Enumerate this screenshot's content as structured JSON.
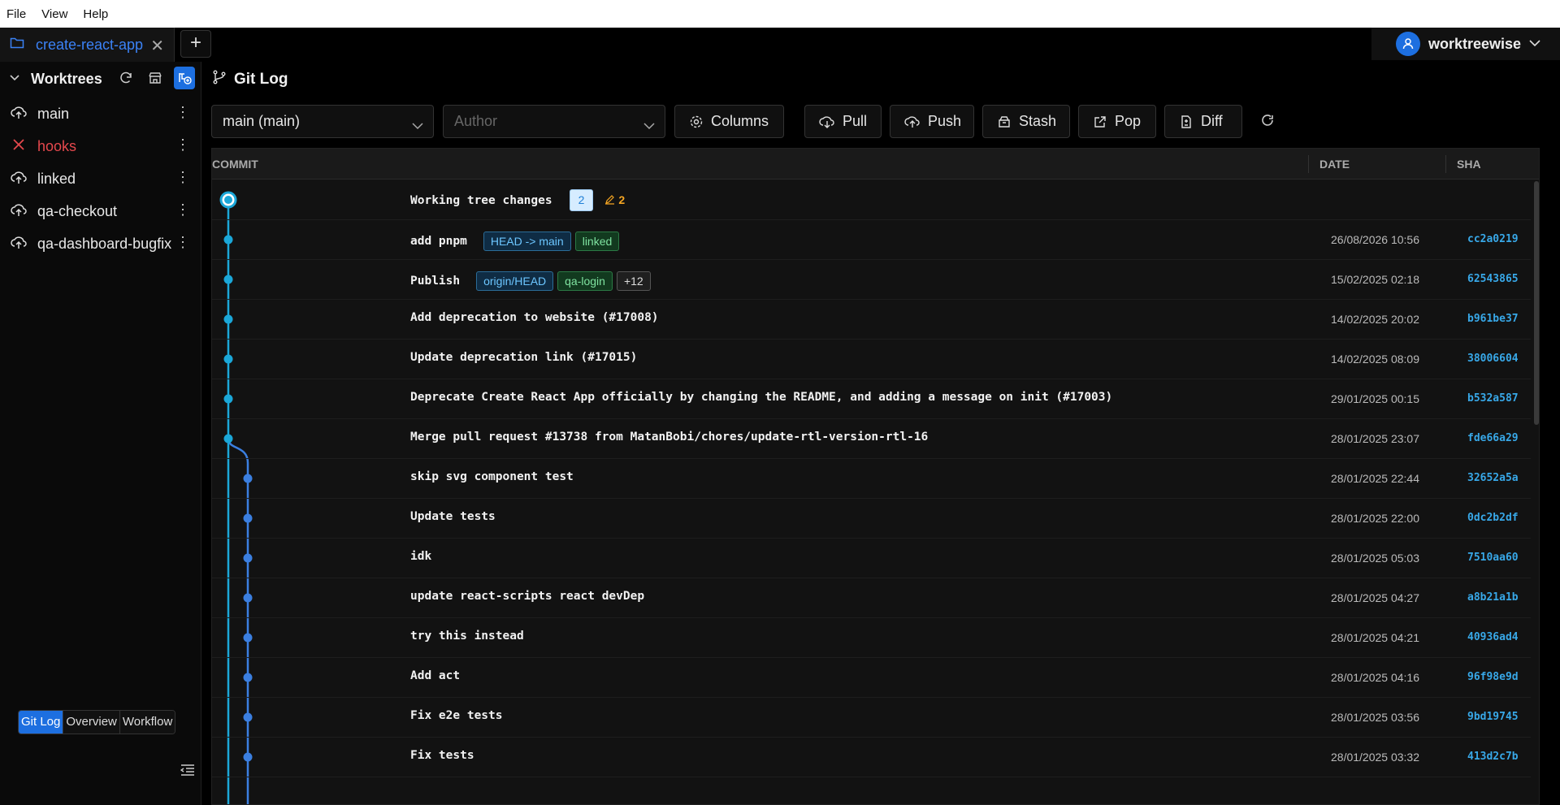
{
  "menu": [
    "File",
    "View",
    "Help"
  ],
  "tab": {
    "label": "create-react-app"
  },
  "user": {
    "name": "worktreewise"
  },
  "sidebar": {
    "title": "Worktrees",
    "items": [
      {
        "label": "main",
        "status": "cloud"
      },
      {
        "label": "hooks",
        "status": "error"
      },
      {
        "label": "linked",
        "status": "cloud"
      },
      {
        "label": "qa-checkout",
        "status": "cloud"
      },
      {
        "label": "qa-dashboard-bugfix",
        "status": "cloud"
      }
    ],
    "view_tabs": [
      "Git Log",
      "Overview",
      "Workflow"
    ]
  },
  "gitlog": {
    "title": "Git Log",
    "branch_select": "main (main)",
    "author_placeholder": "Author",
    "buttons": {
      "columns": "Columns",
      "pull": "Pull",
      "push": "Push",
      "stash": "Stash",
      "pop": "Pop",
      "diff": "Diff"
    },
    "columns": {
      "commit": "COMMIT",
      "date": "DATE",
      "sha": "SHA"
    },
    "working": {
      "label": "Working tree changes",
      "count": "2",
      "changes": "2"
    },
    "rows": [
      {
        "message": "add pnpm",
        "tags": [
          {
            "text": "HEAD -> main",
            "kind": "head"
          },
          {
            "text": "linked",
            "kind": "branch"
          }
        ],
        "date": "26/08/2026 10:56",
        "sha": "cc2a0219"
      },
      {
        "message": "Publish",
        "tags": [
          {
            "text": "origin/HEAD",
            "kind": "head"
          },
          {
            "text": "qa-login",
            "kind": "branch"
          },
          {
            "text": "+12",
            "kind": "more"
          }
        ],
        "date": "15/02/2025 02:18",
        "sha": "62543865"
      },
      {
        "message": "Add deprecation to website (#17008)",
        "tags": [],
        "date": "14/02/2025 20:02",
        "sha": "b961be37"
      },
      {
        "message": "Update deprecation link (#17015)",
        "tags": [],
        "date": "14/02/2025 08:09",
        "sha": "38006604"
      },
      {
        "message": "Deprecate Create React App officially by changing the README, and adding a message on init (#17003)",
        "tags": [],
        "date": "29/01/2025 00:15",
        "sha": "b532a587"
      },
      {
        "message": "Merge pull request #13738 from MatanBobi/chores/update-rtl-version-rtl-16",
        "tags": [],
        "date": "28/01/2025 23:07",
        "sha": "fde66a29"
      },
      {
        "message": "skip svg component test",
        "tags": [],
        "date": "28/01/2025 22:44",
        "sha": "32652a5a"
      },
      {
        "message": "Update tests",
        "tags": [],
        "date": "28/01/2025 22:00",
        "sha": "0dc2b2df"
      },
      {
        "message": "idk",
        "tags": [],
        "date": "28/01/2025 05:03",
        "sha": "7510aa60"
      },
      {
        "message": "update react-scripts react devDep",
        "tags": [],
        "date": "28/01/2025 04:27",
        "sha": "a8b21a1b"
      },
      {
        "message": "try this instead",
        "tags": [],
        "date": "28/01/2025 04:21",
        "sha": "40936ad4"
      },
      {
        "message": "Add act",
        "tags": [],
        "date": "28/01/2025 04:16",
        "sha": "96f98e9d"
      },
      {
        "message": "Fix e2e tests",
        "tags": [],
        "date": "28/01/2025 03:56",
        "sha": "9bd19745"
      },
      {
        "message": "Fix tests",
        "tags": [],
        "date": "28/01/2025 03:32",
        "sha": "413d2c7b"
      }
    ]
  },
  "colors": {
    "accent": "#1d6fe0",
    "graph_main": "#1ba7d8",
    "graph_branch": "#3b7fe0",
    "sha": "#38a8e8",
    "error": "#e5484d"
  },
  "icons": [
    "folder-icon",
    "close-icon",
    "plus-icon",
    "user-icon",
    "chevron-down-icon",
    "refresh-icon",
    "store-icon",
    "add-worktree-icon",
    "cloud-icon",
    "error-x-icon",
    "more-vertical-icon",
    "git-branch-icon",
    "gear-icon",
    "cloud-download-icon",
    "cloud-upload-icon",
    "archive-icon",
    "external-link-icon",
    "file-diff-icon",
    "pencil-icon",
    "collapse-sidebar-icon"
  ]
}
